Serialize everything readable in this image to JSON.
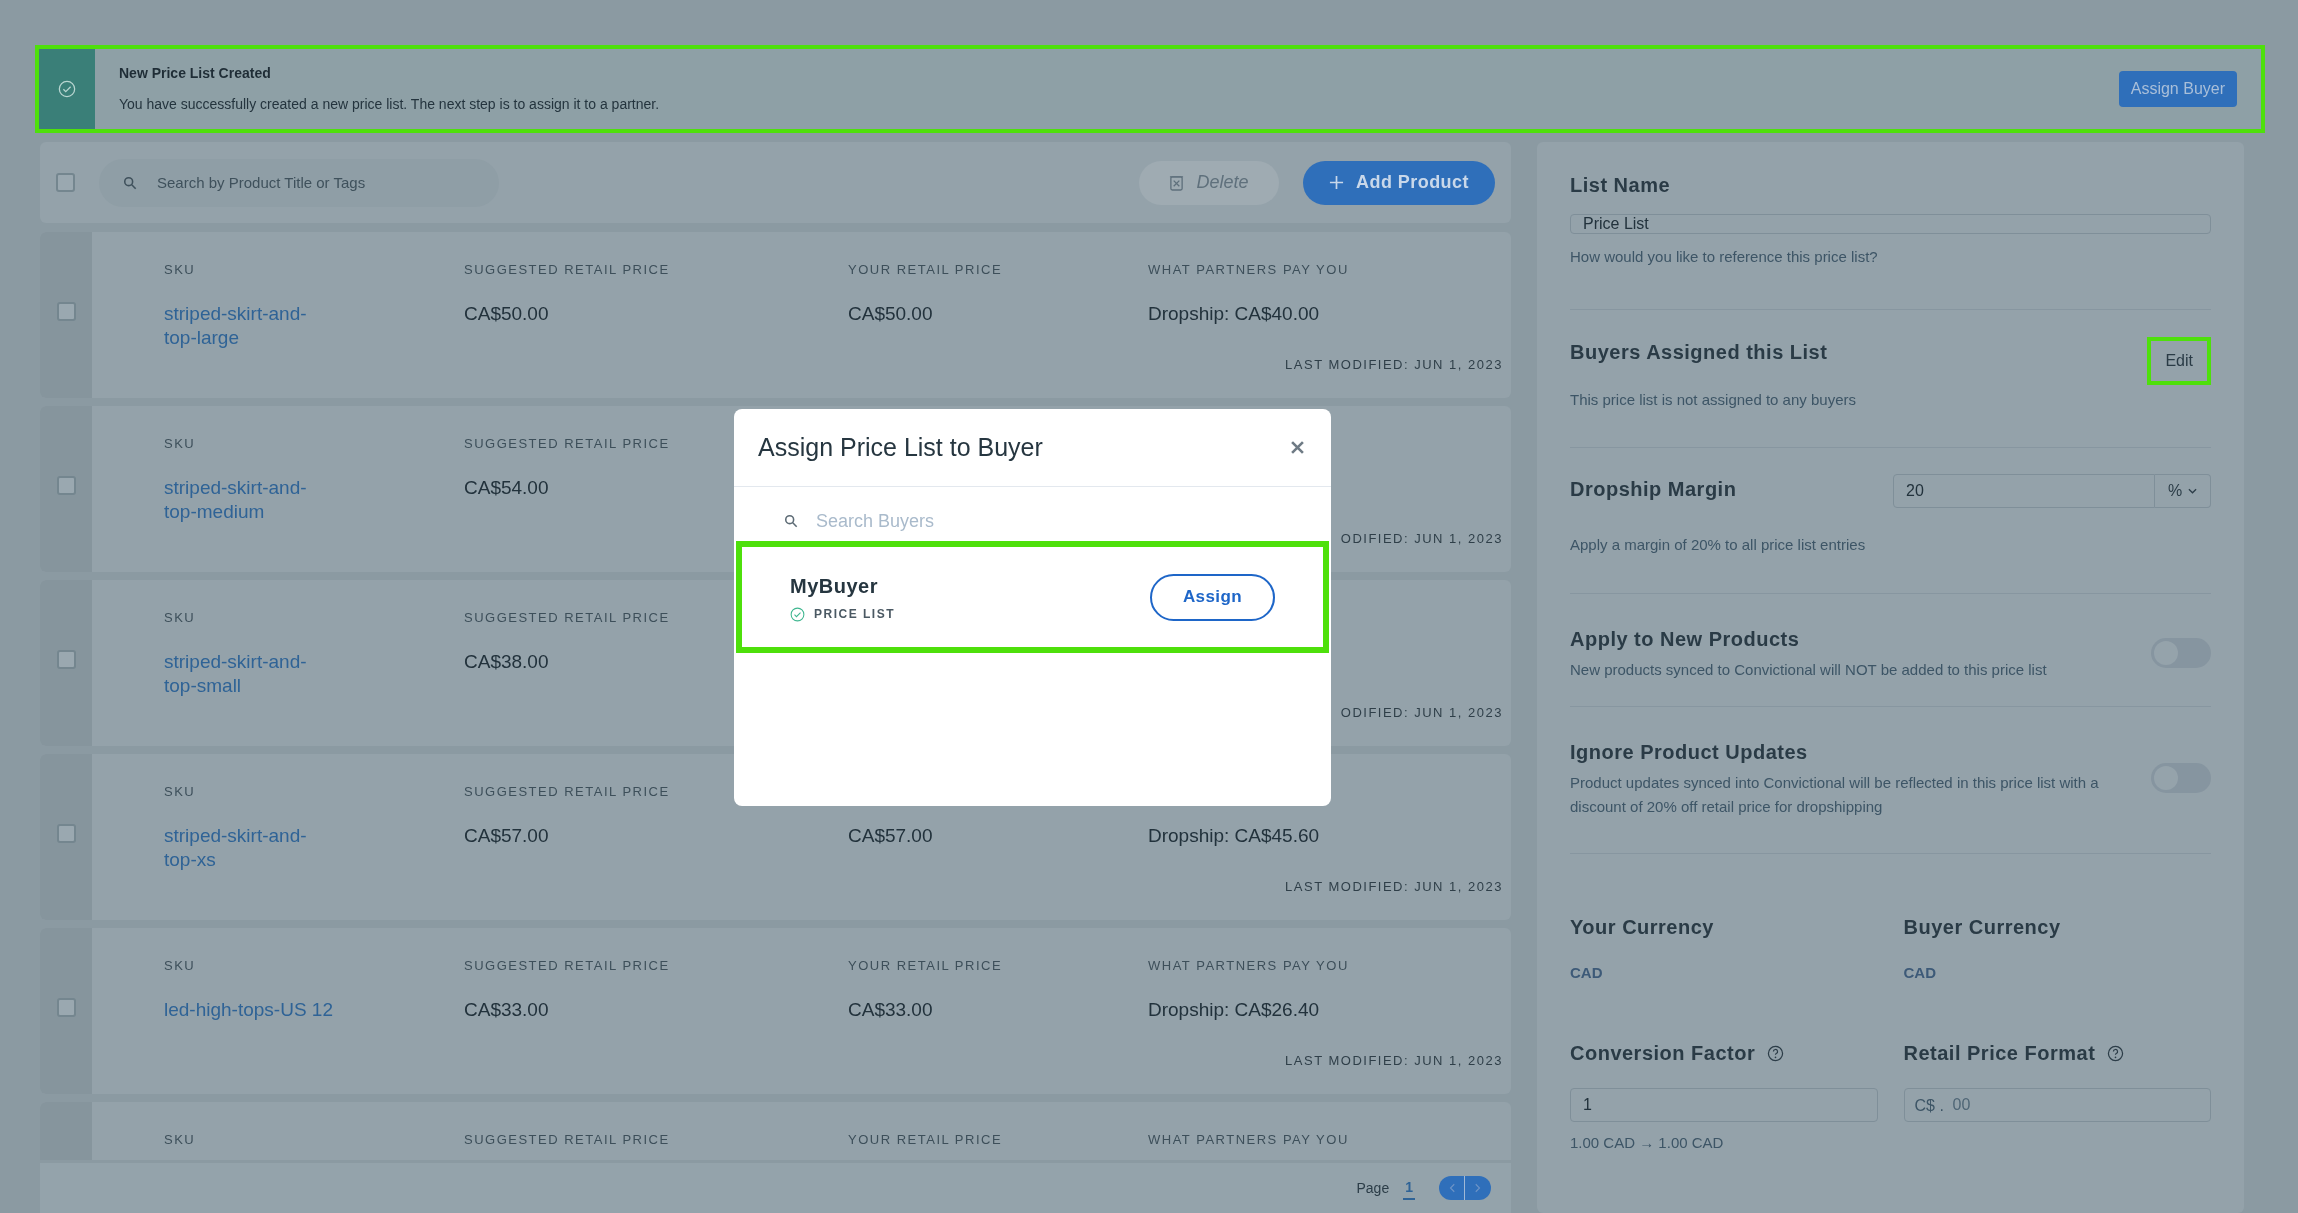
{
  "banner": {
    "title": "New Price List Created",
    "message": "You have successfully created a new price list. The next step is to assign it to a partner.",
    "button": "Assign Buyer",
    "highlighted": true
  },
  "toolbar": {
    "checked": false,
    "search_placeholder": "Search by Product Title or Tags",
    "delete_button": {
      "label": "Delete",
      "disabled": true
    },
    "add_button": "Add Product"
  },
  "rows": [
    {
      "checked": false,
      "cells": [
        {
          "label": "SKU",
          "value": "striped-skirt-and-top-large"
        },
        {
          "label": "SUGGESTED RETAIL PRICE",
          "value": "CA$50.00"
        },
        {
          "label": "YOUR RETAIL PRICE",
          "value": "CA$50.00"
        },
        {
          "label": "WHAT PARTNERS PAY YOU",
          "value": "Dropship: CA$40.00"
        }
      ],
      "modified": "LAST MODIFIED: JUN 1, 2023"
    },
    {
      "checked": false,
      "cells": [
        {
          "label": "SKU",
          "value": "striped-skirt-and-top-medium"
        },
        {
          "label": "SUGGESTED RETAIL PRICE",
          "value": "CA$54.00"
        }
      ],
      "modified": "ODIFIED: JUN 1, 2023"
    },
    {
      "checked": false,
      "cells": [
        {
          "label": "SKU",
          "value": "striped-skirt-and-top-small"
        },
        {
          "label": "SUGGESTED RETAIL PRICE",
          "value": "CA$38.00"
        }
      ],
      "modified": "ODIFIED: JUN 1, 2023"
    },
    {
      "checked": false,
      "cells": [
        {
          "label": "SKU",
          "value": "striped-skirt-and-top-xs"
        },
        {
          "label": "SUGGESTED RETAIL PRICE",
          "value": "CA$57.00"
        },
        {
          "value": "CA$57.00"
        },
        {
          "value": "Dropship: CA$45.60"
        }
      ],
      "modified": "LAST MODIFIED: JUN 1, 2023"
    },
    {
      "checked": false,
      "cells": [
        {
          "label": "SKU",
          "value": "led-high-tops-US 12"
        },
        {
          "label": "SUGGESTED RETAIL PRICE",
          "value": "CA$33.00"
        },
        {
          "label": "YOUR RETAIL PRICE",
          "value": "CA$33.00"
        },
        {
          "label": "WHAT PARTNERS PAY YOU",
          "value": "Dropship: CA$26.40"
        }
      ],
      "modified": "LAST MODIFIED: JUN 1, 2023"
    },
    {
      "cells": [
        {
          "label": "SKU"
        },
        {
          "label": "SUGGESTED RETAIL PRICE"
        },
        {
          "label": "YOUR RETAIL PRICE"
        },
        {
          "label": "WHAT PARTNERS PAY YOU"
        }
      ]
    }
  ],
  "pagination": {
    "label": "Page",
    "current": "1"
  },
  "settings": {
    "list_name": {
      "heading": "List Name",
      "value": "Price List",
      "hint": "How would you like to reference this price list?"
    },
    "buyers": {
      "heading": "Buyers Assigned this List",
      "edit_button": "Edit",
      "edit_highlighted": true,
      "text": "This price list is not assigned to any buyers"
    },
    "margin": {
      "heading": "Dropship Margin",
      "value": "20",
      "unit": "%",
      "hint": "Apply a margin of 20% to all price list entries"
    },
    "toggles": [
      {
        "heading": "Apply to New Products",
        "text": "New products synced to Convictional will NOT be added to this price list",
        "on": false
      },
      {
        "heading": "Ignore Product Updates",
        "text": "Product updates synced into Convictional will be reflected in this price list with a discount of 20% off retail price for dropshipping",
        "on": false
      }
    ],
    "currencies": [
      {
        "heading": "Your Currency",
        "value": "CAD"
      },
      {
        "heading": "Buyer Currency",
        "value": "CAD"
      }
    ],
    "conversion": {
      "heading": "Conversion Factor",
      "value": "1",
      "hint": "1.00 CAD → 1.00 CAD"
    },
    "format": {
      "heading": "Retail Price Format",
      "prefix": "C$ .",
      "placeholder": "00"
    }
  },
  "modal": {
    "title": "Assign Price List to Buyer",
    "search_placeholder": "Search Buyers",
    "buyers": [
      {
        "name": "MyBuyer",
        "tag": "PRICE LIST",
        "button": "Assign",
        "highlighted": true
      }
    ]
  }
}
